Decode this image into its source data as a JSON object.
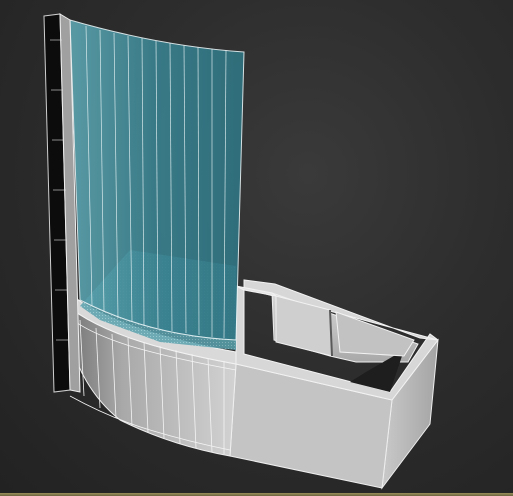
{
  "viewport": {
    "background": "#2d2d2d",
    "wire_color": "#f0f0f0",
    "glass_color": "#3f8d9c",
    "body_color": "#bdbdbd",
    "frame_color": "#8c8c8c",
    "water_color": "#5fa9b8",
    "strip_color": "#9a8f5a"
  }
}
